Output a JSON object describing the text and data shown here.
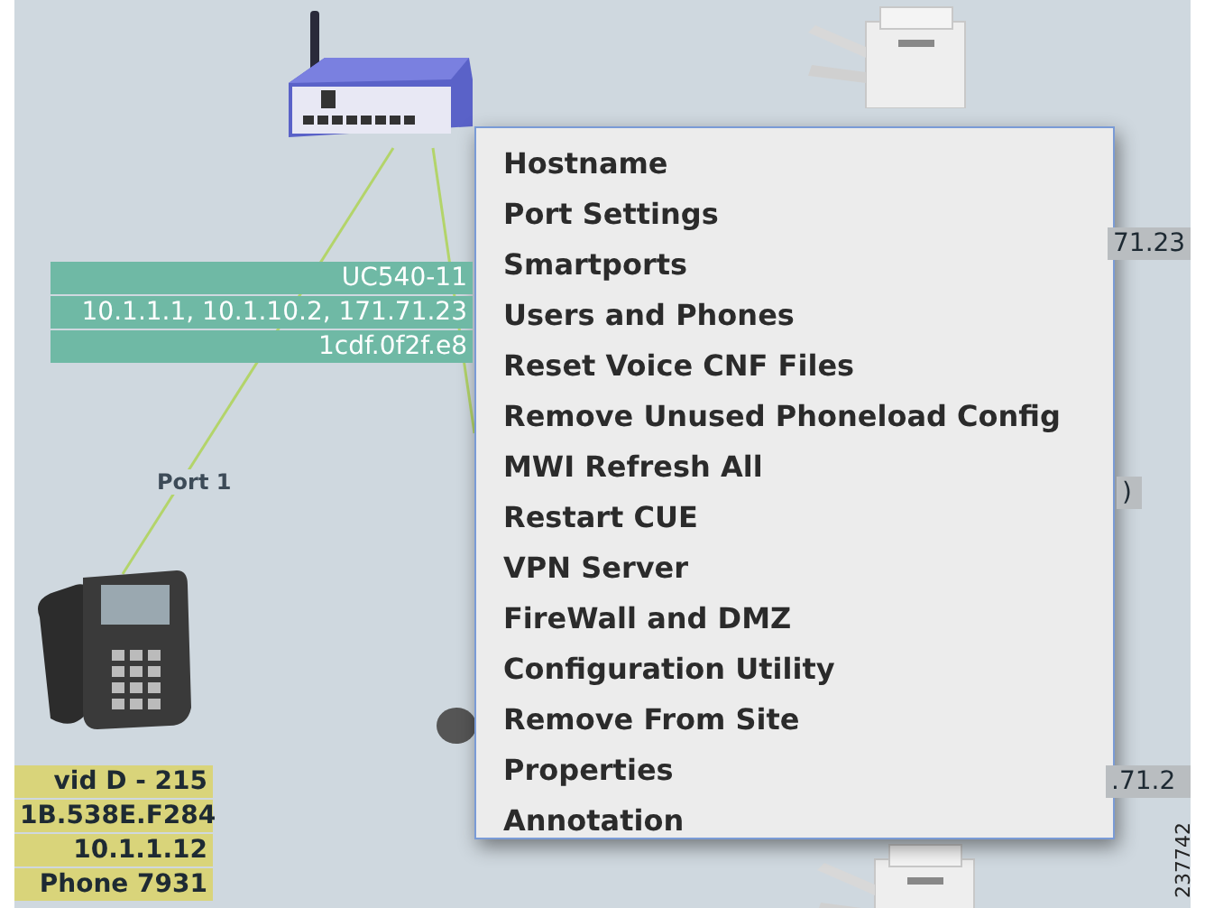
{
  "topology": {
    "devices": [
      {
        "kind": "router",
        "color": "#6fb9a5",
        "label_lines": [
          "UC540-11",
          "10.1.1.1, 10.1.10.2, 171.71.23",
          "1cdf.0f2f.e8"
        ]
      },
      {
        "kind": "printer",
        "color": "#b9bdc0",
        "label_lines": [
          "71.23"
        ]
      },
      {
        "kind": "hidden",
        "color": "#b9bdc0",
        "label_lines": [
          ")"
        ]
      },
      {
        "kind": "phone",
        "color": "#d9d47a",
        "label_lines": [
          "vid D - 215",
          "1B.538E.F284",
          "10.1.1.12",
          "Phone 7931"
        ]
      },
      {
        "kind": "printer",
        "color": "#b9bdc0",
        "label_lines": [
          ".71.2"
        ]
      },
      {
        "kind": "printer"
      }
    ],
    "links": [
      {
        "label": "Port 1"
      }
    ]
  },
  "context_menu": {
    "items": [
      "Hostname",
      "Port Settings",
      "Smartports",
      "Users and Phones",
      "Reset Voice CNF Files",
      "Remove Unused Phoneload Config",
      "MWI Refresh All",
      "Restart CUE",
      "VPN Server",
      "FireWall and DMZ",
      "Configuration Utility",
      "Remove From Site",
      "Properties",
      "Annotation"
    ]
  },
  "figure_number": "237742"
}
